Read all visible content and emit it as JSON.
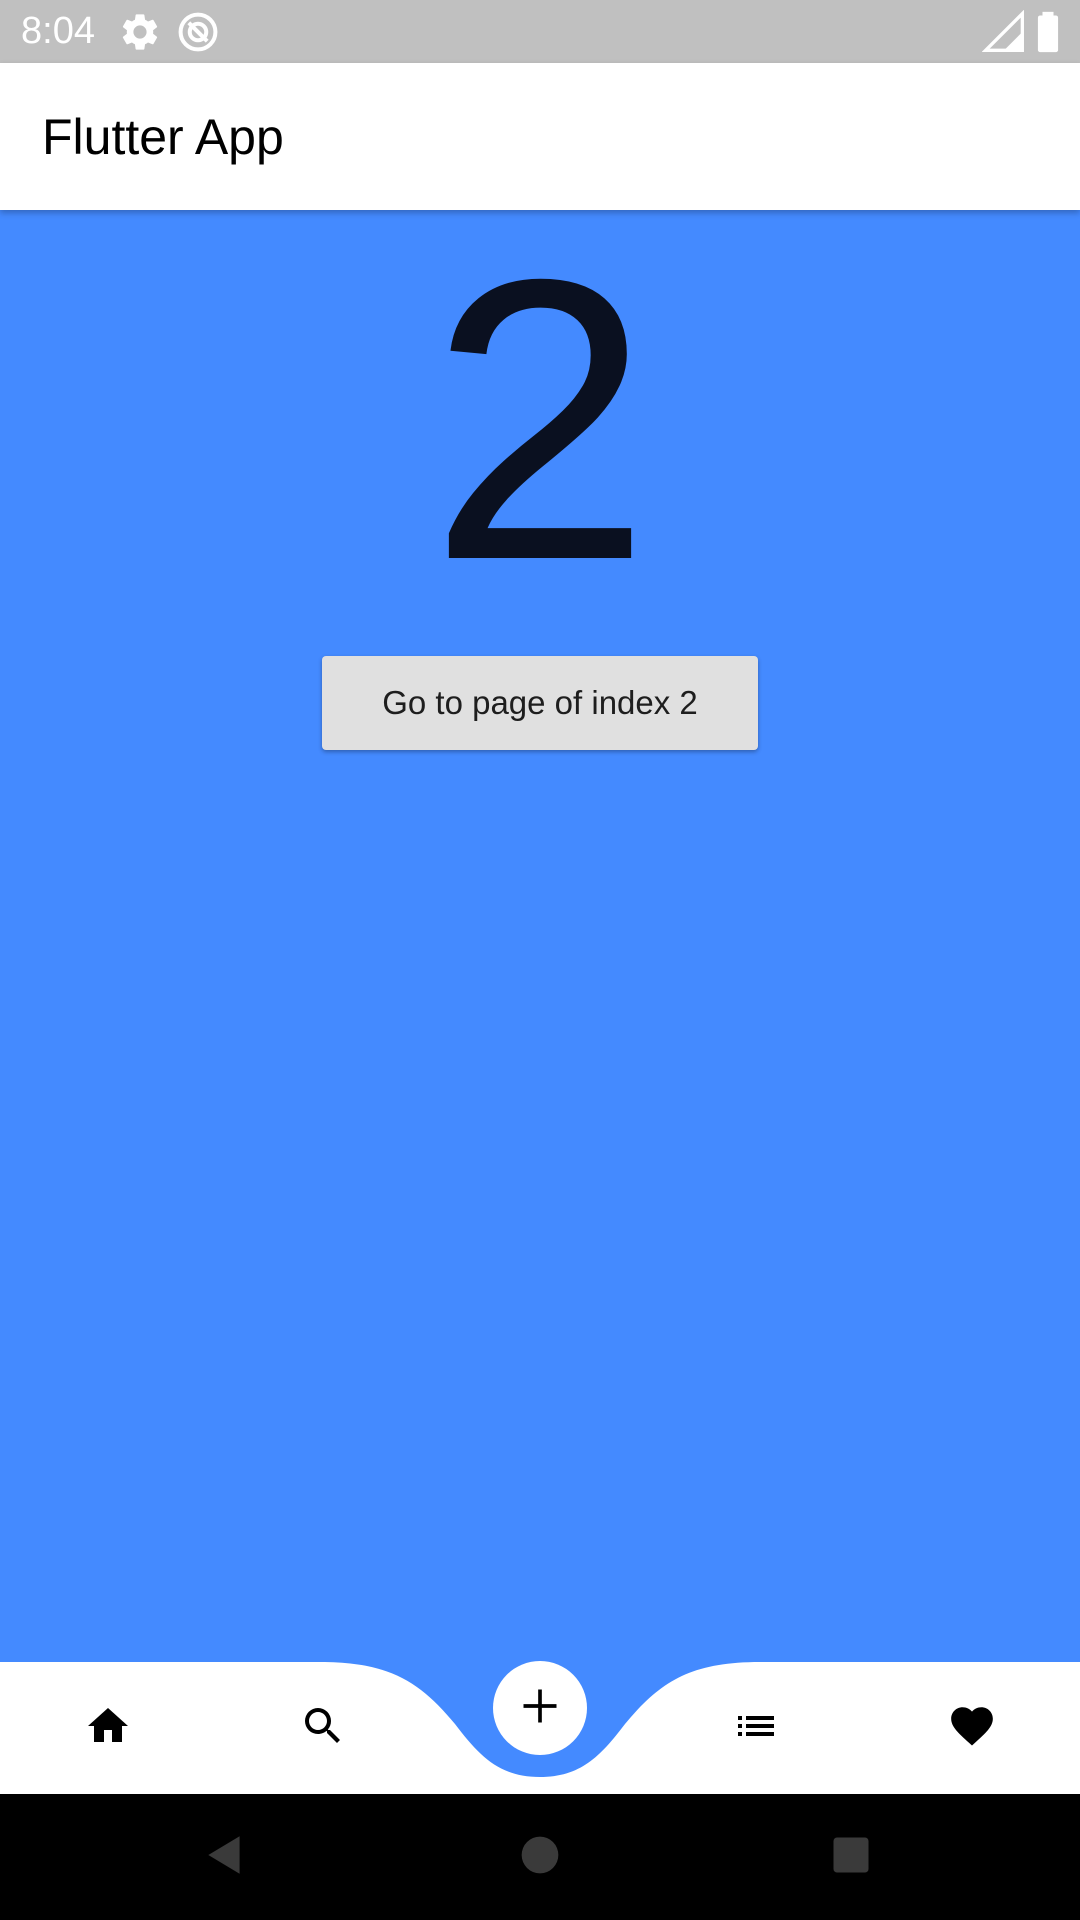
{
  "status_bar": {
    "time": "8:04",
    "icons": [
      "gear-icon",
      "sync-icon",
      "signal-icon",
      "battery-icon"
    ],
    "background": "#C0C0C0"
  },
  "app_bar": {
    "title": "Flutter App"
  },
  "body": {
    "counter": "2",
    "button_label": "Go to page of index 2",
    "background": "#448AFF"
  },
  "bottom_nav": {
    "items": [
      {
        "icon": "home-icon"
      },
      {
        "icon": "search-icon"
      },
      {
        "icon": "add-icon"
      },
      {
        "icon": "list-icon"
      },
      {
        "icon": "heart-icon"
      }
    ],
    "selected_index": 2
  },
  "system_nav": {
    "buttons": [
      "back-icon",
      "home-circle-icon",
      "recents-icon"
    ]
  }
}
